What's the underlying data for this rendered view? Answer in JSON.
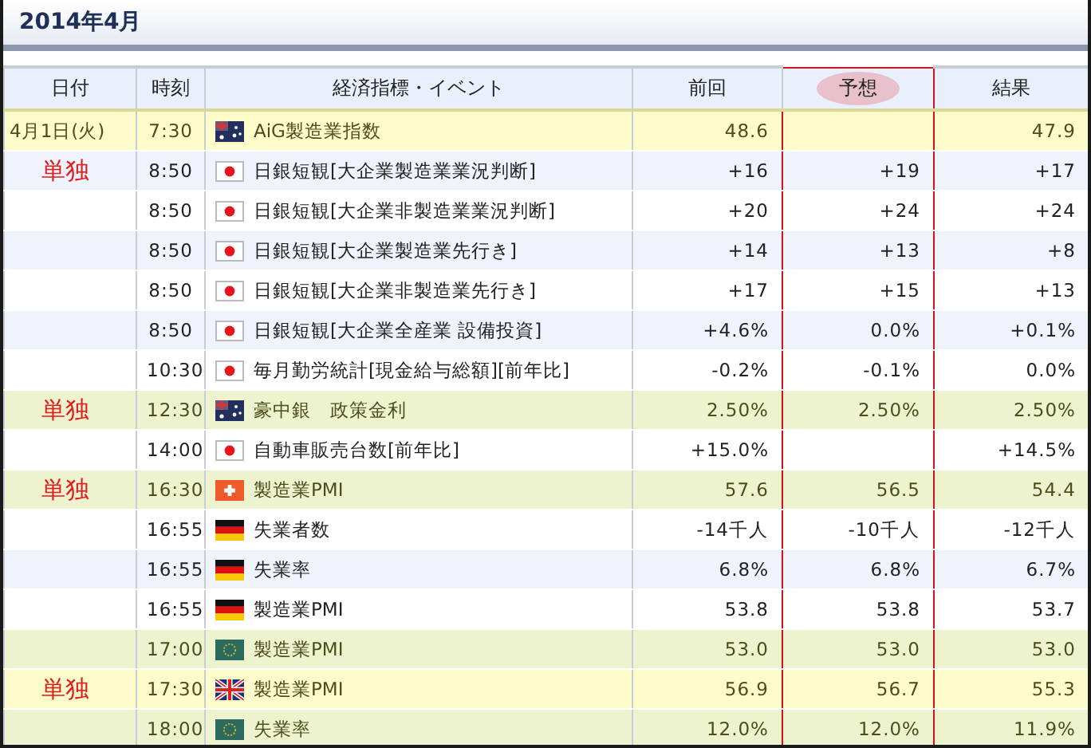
{
  "title": "2014年4月",
  "columns": [
    {
      "label": "日付",
      "framed": false,
      "circled": false
    },
    {
      "label": "時刻",
      "framed": false,
      "circled": false
    },
    {
      "label": "経済指標・イベント",
      "framed": false,
      "circled": false
    },
    {
      "label": "前回",
      "framed": false,
      "circled": false
    },
    {
      "label": "予想",
      "framed": true,
      "circled": true
    },
    {
      "label": "結果",
      "framed": false,
      "circled": false
    }
  ],
  "rows": [
    {
      "kind": "alert",
      "date": "4月1日(火)",
      "time": "7:30",
      "flag": {
        "kind": "au"
      },
      "event": "AiG製造業指数",
      "previous": "48.6",
      "result": "47.9"
    },
    {
      "kind": "shaded",
      "note": "単独",
      "time": "8:50",
      "flag": {
        "kind": "jp"
      },
      "event": "日銀短観[大企業製造業業況判断]",
      "previous": "+16",
      "forecast": "+19",
      "result": "+17"
    },
    {
      "kind": "plain",
      "time": "8:50",
      "flag": {
        "kind": "jp"
      },
      "event": "日銀短観[大企業非製造業業況判断]",
      "previous": "+20",
      "forecast": "+24",
      "result": "+24"
    },
    {
      "kind": "shaded",
      "time": "8:50",
      "flag": {
        "kind": "jp"
      },
      "event": "日銀短観[大企業製造業先行き]",
      "previous": "+14",
      "forecast": "+13",
      "result": "+8"
    },
    {
      "kind": "plain",
      "time": "8:50",
      "flag": {
        "kind": "jp"
      },
      "event": "日銀短観[大企業非製造業先行き]",
      "previous": "+17",
      "forecast": "+15",
      "result": "+13"
    },
    {
      "kind": "shaded",
      "time": "8:50",
      "flag": {
        "kind": "jp"
      },
      "event": "日銀短観[大企業全産業 設備投資]",
      "previous": "+4.6%",
      "forecast": "0.0%",
      "result": "+0.1%"
    },
    {
      "kind": "plain",
      "time": "10:30",
      "flag": {
        "kind": "jp"
      },
      "event": "毎月勤労統計[現金給与総額][前年比]",
      "previous": "-0.2%",
      "forecast": "-0.1%",
      "result": "0.0%"
    },
    {
      "kind": "minor",
      "note": "単独",
      "time": "12:30",
      "flag": {
        "kind": "au"
      },
      "event": "豪中銀　政策金利",
      "previous": "2.50%",
      "forecast": "2.50%",
      "result": "2.50%"
    },
    {
      "kind": "plain",
      "time": "14:00",
      "flag": {
        "kind": "jp"
      },
      "event": "自動車販売台数[前年比]",
      "previous": "+15.0%",
      "result": "+14.5%"
    },
    {
      "kind": "minor",
      "note": "単独",
      "time": "16:30",
      "flag": {
        "kind": "ch"
      },
      "event": "製造業PMI",
      "previous": "57.6",
      "forecast": "56.5",
      "result": "54.4"
    },
    {
      "kind": "plain",
      "time": "16:55",
      "flag": {
        "kind": "de"
      },
      "event": "失業者数",
      "previous": "-14千人",
      "forecast": "-10千人",
      "result": "-12千人"
    },
    {
      "kind": "shaded",
      "time": "16:55",
      "flag": {
        "kind": "de"
      },
      "event": "失業率",
      "previous": "6.8%",
      "forecast": "6.8%",
      "result": "6.7%"
    },
    {
      "kind": "plain",
      "time": "16:55",
      "flag": {
        "kind": "de"
      },
      "event": "製造業PMI",
      "previous": "53.8",
      "forecast": "53.8",
      "result": "53.7"
    },
    {
      "kind": "minor",
      "time": "17:00",
      "flag": {
        "kind": "eu"
      },
      "event": "製造業PMI",
      "previous": "53.0",
      "forecast": "53.0",
      "result": "53.0"
    },
    {
      "kind": "alert",
      "note": "単独",
      "time": "17:30",
      "flag": {
        "kind": "uk"
      },
      "event": "製造業PMI",
      "previous": "56.9",
      "forecast": "56.7",
      "result": "55.3"
    },
    {
      "kind": "minor",
      "time": "18:00",
      "flag": {
        "kind": "eu"
      },
      "event": "失業率",
      "previous": "12.0%",
      "forecast": "12.0%",
      "result": "11.9%"
    }
  ]
}
